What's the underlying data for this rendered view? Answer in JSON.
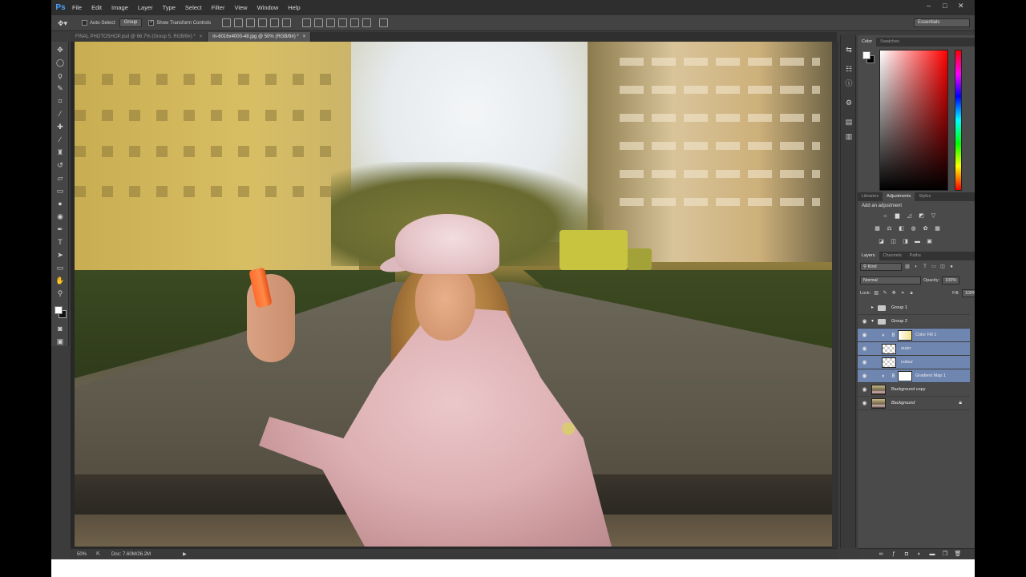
{
  "app": {
    "logo": "Ps",
    "menu": [
      "File",
      "Edit",
      "Image",
      "Layer",
      "Type",
      "Select",
      "Filter",
      "View",
      "Window",
      "Help"
    ],
    "window_controls": {
      "minimize": "–",
      "maximize": "□",
      "close": "✕"
    }
  },
  "options_bar": {
    "auto_select_label": "Auto-Select:",
    "auto_select_value": "Group",
    "show_transform_label": "Show Transform Controls",
    "workspace": "Essentials"
  },
  "tabs": [
    {
      "label": "FINAL PHOTOSHOP.psd @ 66.7% (Group 5, RGB/8#) *",
      "close": "×"
    },
    {
      "label": "m-6016x4000-48.jpg @ 50% (RGB/8#) *",
      "close": "×"
    }
  ],
  "status": {
    "zoom": "50%",
    "doc": "Doc: 7.60M/26.2M",
    "arrow": "▶"
  },
  "panels": {
    "color_tabs": [
      "Color",
      "Swatches"
    ],
    "adj_tabs": [
      "Libraries",
      "Adjustments",
      "Styles"
    ],
    "adj_label": "Add an adjustment",
    "layer_tabs": [
      "Layers",
      "Channels",
      "Paths"
    ],
    "kind": "Kind",
    "blend_mode": "Normal",
    "opacity_label": "Opacity:",
    "opacity_value": "100%",
    "lock_label": "Lock:",
    "fill_label": "Fill:",
    "fill_value": "100%"
  },
  "layers": [
    {
      "name": "Group 1"
    },
    {
      "name": "Group 2"
    },
    {
      "name": "Color Fill 1"
    },
    {
      "name": "outer"
    },
    {
      "name": "colour"
    },
    {
      "name": "Gradient Map 1"
    },
    {
      "name": "Background copy"
    },
    {
      "name": "Background"
    }
  ],
  "colors": {
    "accent": "#6f86b1",
    "phone": "#ff6b2d"
  }
}
